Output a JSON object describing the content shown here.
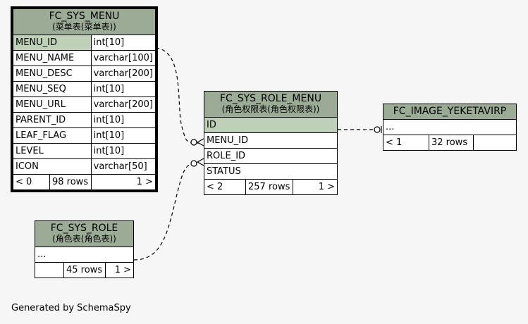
{
  "tables": {
    "menu": {
      "name": "FC_SYS_MENU",
      "comment": "(菜单表(菜单表))",
      "columns": [
        {
          "name": "MENU_ID",
          "type": "int[10]"
        },
        {
          "name": "MENU_NAME",
          "type": "varchar[100]"
        },
        {
          "name": "MENU_DESC",
          "type": "varchar[200]"
        },
        {
          "name": "MENU_SEQ",
          "type": "int[10]"
        },
        {
          "name": "MENU_URL",
          "type": "varchar[200]"
        },
        {
          "name": "PARENT_ID",
          "type": "int[10]"
        },
        {
          "name": "LEAF_FLAG",
          "type": "int[10]"
        },
        {
          "name": "LEVEL",
          "type": "int[10]"
        },
        {
          "name": "ICON",
          "type": "varchar[50]"
        }
      ],
      "footer": {
        "parents": "< 0",
        "rows": "98 rows",
        "children": "1 >"
      }
    },
    "role_menu": {
      "name": "FC_SYS_ROLE_MENU",
      "comment": "(角色权限表(角色权限表))",
      "columns": [
        {
          "name": "ID"
        },
        {
          "name": "MENU_ID"
        },
        {
          "name": "ROLE_ID"
        },
        {
          "name": "STATUS"
        }
      ],
      "footer": {
        "parents": "< 2",
        "rows": "257 rows",
        "children": "1 >"
      }
    },
    "image": {
      "name": "FC_IMAGE_YEKETAVIRP",
      "columns": [
        {
          "name": "..."
        }
      ],
      "footer": {
        "parents": "< 1",
        "rows": "32 rows",
        "children": ""
      }
    },
    "role": {
      "name": "FC_SYS_ROLE",
      "comment": "(角色表(角色表))",
      "columns": [
        {
          "name": "..."
        }
      ],
      "footer": {
        "parents": "",
        "rows": "45 rows",
        "children": "1 >"
      }
    }
  },
  "footer_text": "Generated by SchemaSpy"
}
